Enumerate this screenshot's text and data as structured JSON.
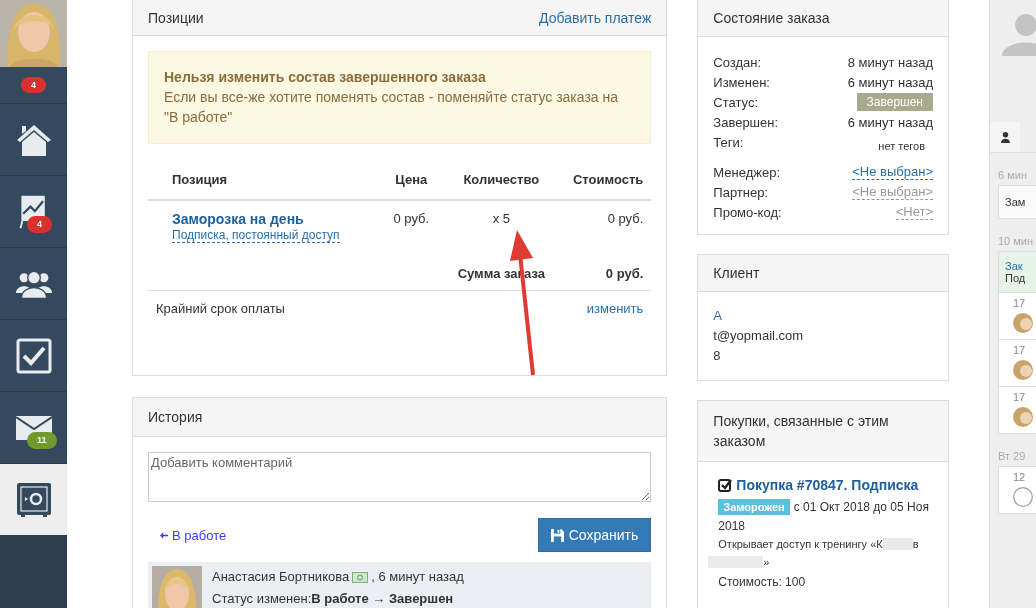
{
  "sidebar": {
    "top_badge": {
      "text": "4",
      "color": "#d9312f"
    },
    "items": [
      {
        "kind": "home",
        "selected": false
      },
      {
        "kind": "chart",
        "selected": false,
        "badge": {
          "text": "4",
          "color": "#d9312f"
        }
      },
      {
        "kind": "people",
        "selected": false
      },
      {
        "kind": "check",
        "selected": false
      },
      {
        "kind": "mail",
        "selected": false,
        "badge": {
          "text": "11",
          "color": "#6f9a2e"
        }
      },
      {
        "kind": "safe",
        "selected": true
      }
    ]
  },
  "positions": {
    "title": "Позиции",
    "action": "Добавить платеж",
    "alert": {
      "title": "Нельзя изменить состав завершенного заказа",
      "text": "Если вы все-же хотите поменять состав - поменяйте статус заказа на \"В работе\""
    },
    "columns": [
      "Позиция",
      "Цена",
      "Количество",
      "Стоимость"
    ],
    "rows": [
      {
        "name": "Заморозка на день",
        "subtitle": "Подписка, постоянный доступ",
        "price": "0 руб.",
        "quantity": "x 5",
        "cost": "0 руб."
      }
    ],
    "total_label": "Сумма заказа",
    "total": "0 руб.",
    "deadline_label": "Крайний срок оплаты",
    "deadline_action": "изменить"
  },
  "history": {
    "title": "История",
    "comment_placeholder": "Добавить комментарий",
    "back_link": "В работе",
    "save": "Сохранить",
    "entries": [
      {
        "author": "Анастасия Бортникова",
        "time": ", 6 минут назад",
        "label": "Статус изменен:",
        "change": "В работе → Завершен"
      }
    ]
  },
  "order_state": {
    "title": "Состояние заказа",
    "fields": [
      {
        "kind": "text",
        "label": "Создан:",
        "value": "8 минут назад"
      },
      {
        "kind": "text",
        "label": "Изменен:",
        "value": "6 минут назад"
      },
      {
        "kind": "badge",
        "label": "Статус:",
        "value": "Завершен"
      },
      {
        "kind": "text",
        "label": "Завершен:",
        "value": "6 минут назад"
      },
      {
        "kind": "tags",
        "label": "Теги:",
        "value": "нет тегов"
      },
      {
        "kind": "link",
        "label": "Менеджер:",
        "value": "<Не выбран>"
      },
      {
        "kind": "muted_link",
        "label": "Партнер:",
        "value": "<Не выбран>"
      },
      {
        "kind": "muted_link",
        "label": "Промо-код:",
        "value": "<Нет>"
      }
    ]
  },
  "client": {
    "title": "Клиент",
    "name": "А",
    "email": "t@yopmail.com",
    "phone": "8"
  },
  "purchases": {
    "title": "Покупки, связанные с этим заказом",
    "items": [
      {
        "title": "Покупка #70847. Подписка",
        "status": "Заморожен",
        "period": "с 01 Окт 2018 до 05 Ноя",
        "period_end": "2018",
        "access_start": "Открывает доступ к тренингу «К",
        "access_mid": "в",
        "access_end": "»",
        "cost": "Стоимость: 100"
      }
    ]
  },
  "feed": {
    "groups": [
      {
        "time": "6 мин",
        "cards": [
          {
            "kind": "plain",
            "lines": [
              "Зам"
            ]
          }
        ]
      },
      {
        "time": "10 мин",
        "cards": [
          {
            "kind": "green",
            "lines": [
              "Зак",
              "Под"
            ]
          },
          {
            "kind": "avatar",
            "lines": [
              "17"
            ]
          },
          {
            "kind": "avatar",
            "lines": [
              "17"
            ]
          },
          {
            "kind": "avatar",
            "lines": [
              "17"
            ]
          }
        ]
      },
      {
        "time": "Вт 29",
        "cards": [
          {
            "kind": "empty_avatar",
            "lines": [
              "12"
            ]
          }
        ]
      }
    ]
  }
}
